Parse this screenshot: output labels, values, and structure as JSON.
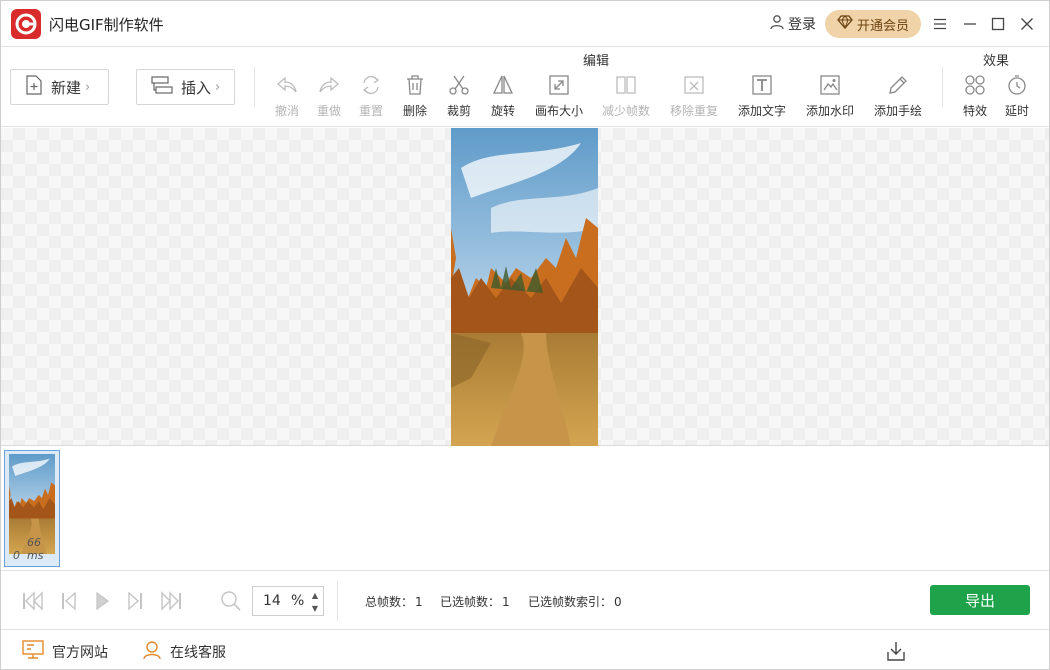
{
  "titlebar": {
    "app_title": "闪电GIF制作软件",
    "login_label": "登录",
    "vip_label": "开通会员",
    "icons": [
      "app-logo-icon",
      "user-icon",
      "diamond-icon",
      "menu-icon",
      "minimize-icon",
      "maximize-icon",
      "close-icon"
    ]
  },
  "toolbar": {
    "new_label": "新建",
    "insert_label": "插入",
    "edit_group_label": "编辑",
    "effects_group_label": "效果",
    "tools": [
      {
        "label": "撤消",
        "icon": "undo-icon",
        "enabled": false
      },
      {
        "label": "重做",
        "icon": "redo-icon",
        "enabled": false
      },
      {
        "label": "重置",
        "icon": "reset-icon",
        "enabled": false
      },
      {
        "label": "删除",
        "icon": "trash-icon",
        "enabled": true
      },
      {
        "label": "裁剪",
        "icon": "scissors-icon",
        "enabled": true
      },
      {
        "label": "旋转",
        "icon": "flip-icon",
        "enabled": true
      },
      {
        "label": "画布大小",
        "icon": "canvas-resize-icon",
        "enabled": true
      },
      {
        "label": "减少帧数",
        "icon": "reduce-frames-icon",
        "enabled": false
      },
      {
        "label": "移除重复",
        "icon": "remove-duplicate-icon",
        "enabled": false
      },
      {
        "label": "添加文字",
        "icon": "text-icon",
        "enabled": true
      },
      {
        "label": "添加水印",
        "icon": "watermark-icon",
        "enabled": true
      },
      {
        "label": "添加手绘",
        "icon": "pencil-icon",
        "enabled": true
      }
    ],
    "effects": [
      {
        "label": "特效",
        "icon": "effects-icon",
        "enabled": true
      },
      {
        "label": "延时",
        "icon": "timer-icon",
        "enabled": true
      }
    ]
  },
  "frames": {
    "items": [
      {
        "index": "0",
        "duration": "66 ms"
      }
    ]
  },
  "controls": {
    "zoom_value": "14",
    "zoom_unit": "%",
    "total_frames_label": "总帧数：",
    "total_frames": "1",
    "selected_frames_label": "已选帧数：",
    "selected_frames": "1",
    "selected_index_label": "已选帧数索引：",
    "selected_index": "0",
    "export_label": "导出",
    "icons": [
      "first-frame-icon",
      "prev-frame-icon",
      "play-icon",
      "next-frame-icon",
      "last-frame-icon",
      "zoom-icon"
    ]
  },
  "footer": {
    "website_label": "官方网站",
    "support_label": "在线客服",
    "icons": [
      "monitor-icon",
      "support-icon",
      "download-icon"
    ]
  },
  "colors": {
    "accent_green": "#1ea34a",
    "vip_gold": "#f0d3a8",
    "logo_red": "#d92b2b",
    "disabled_gray": "#b4b4b4"
  }
}
